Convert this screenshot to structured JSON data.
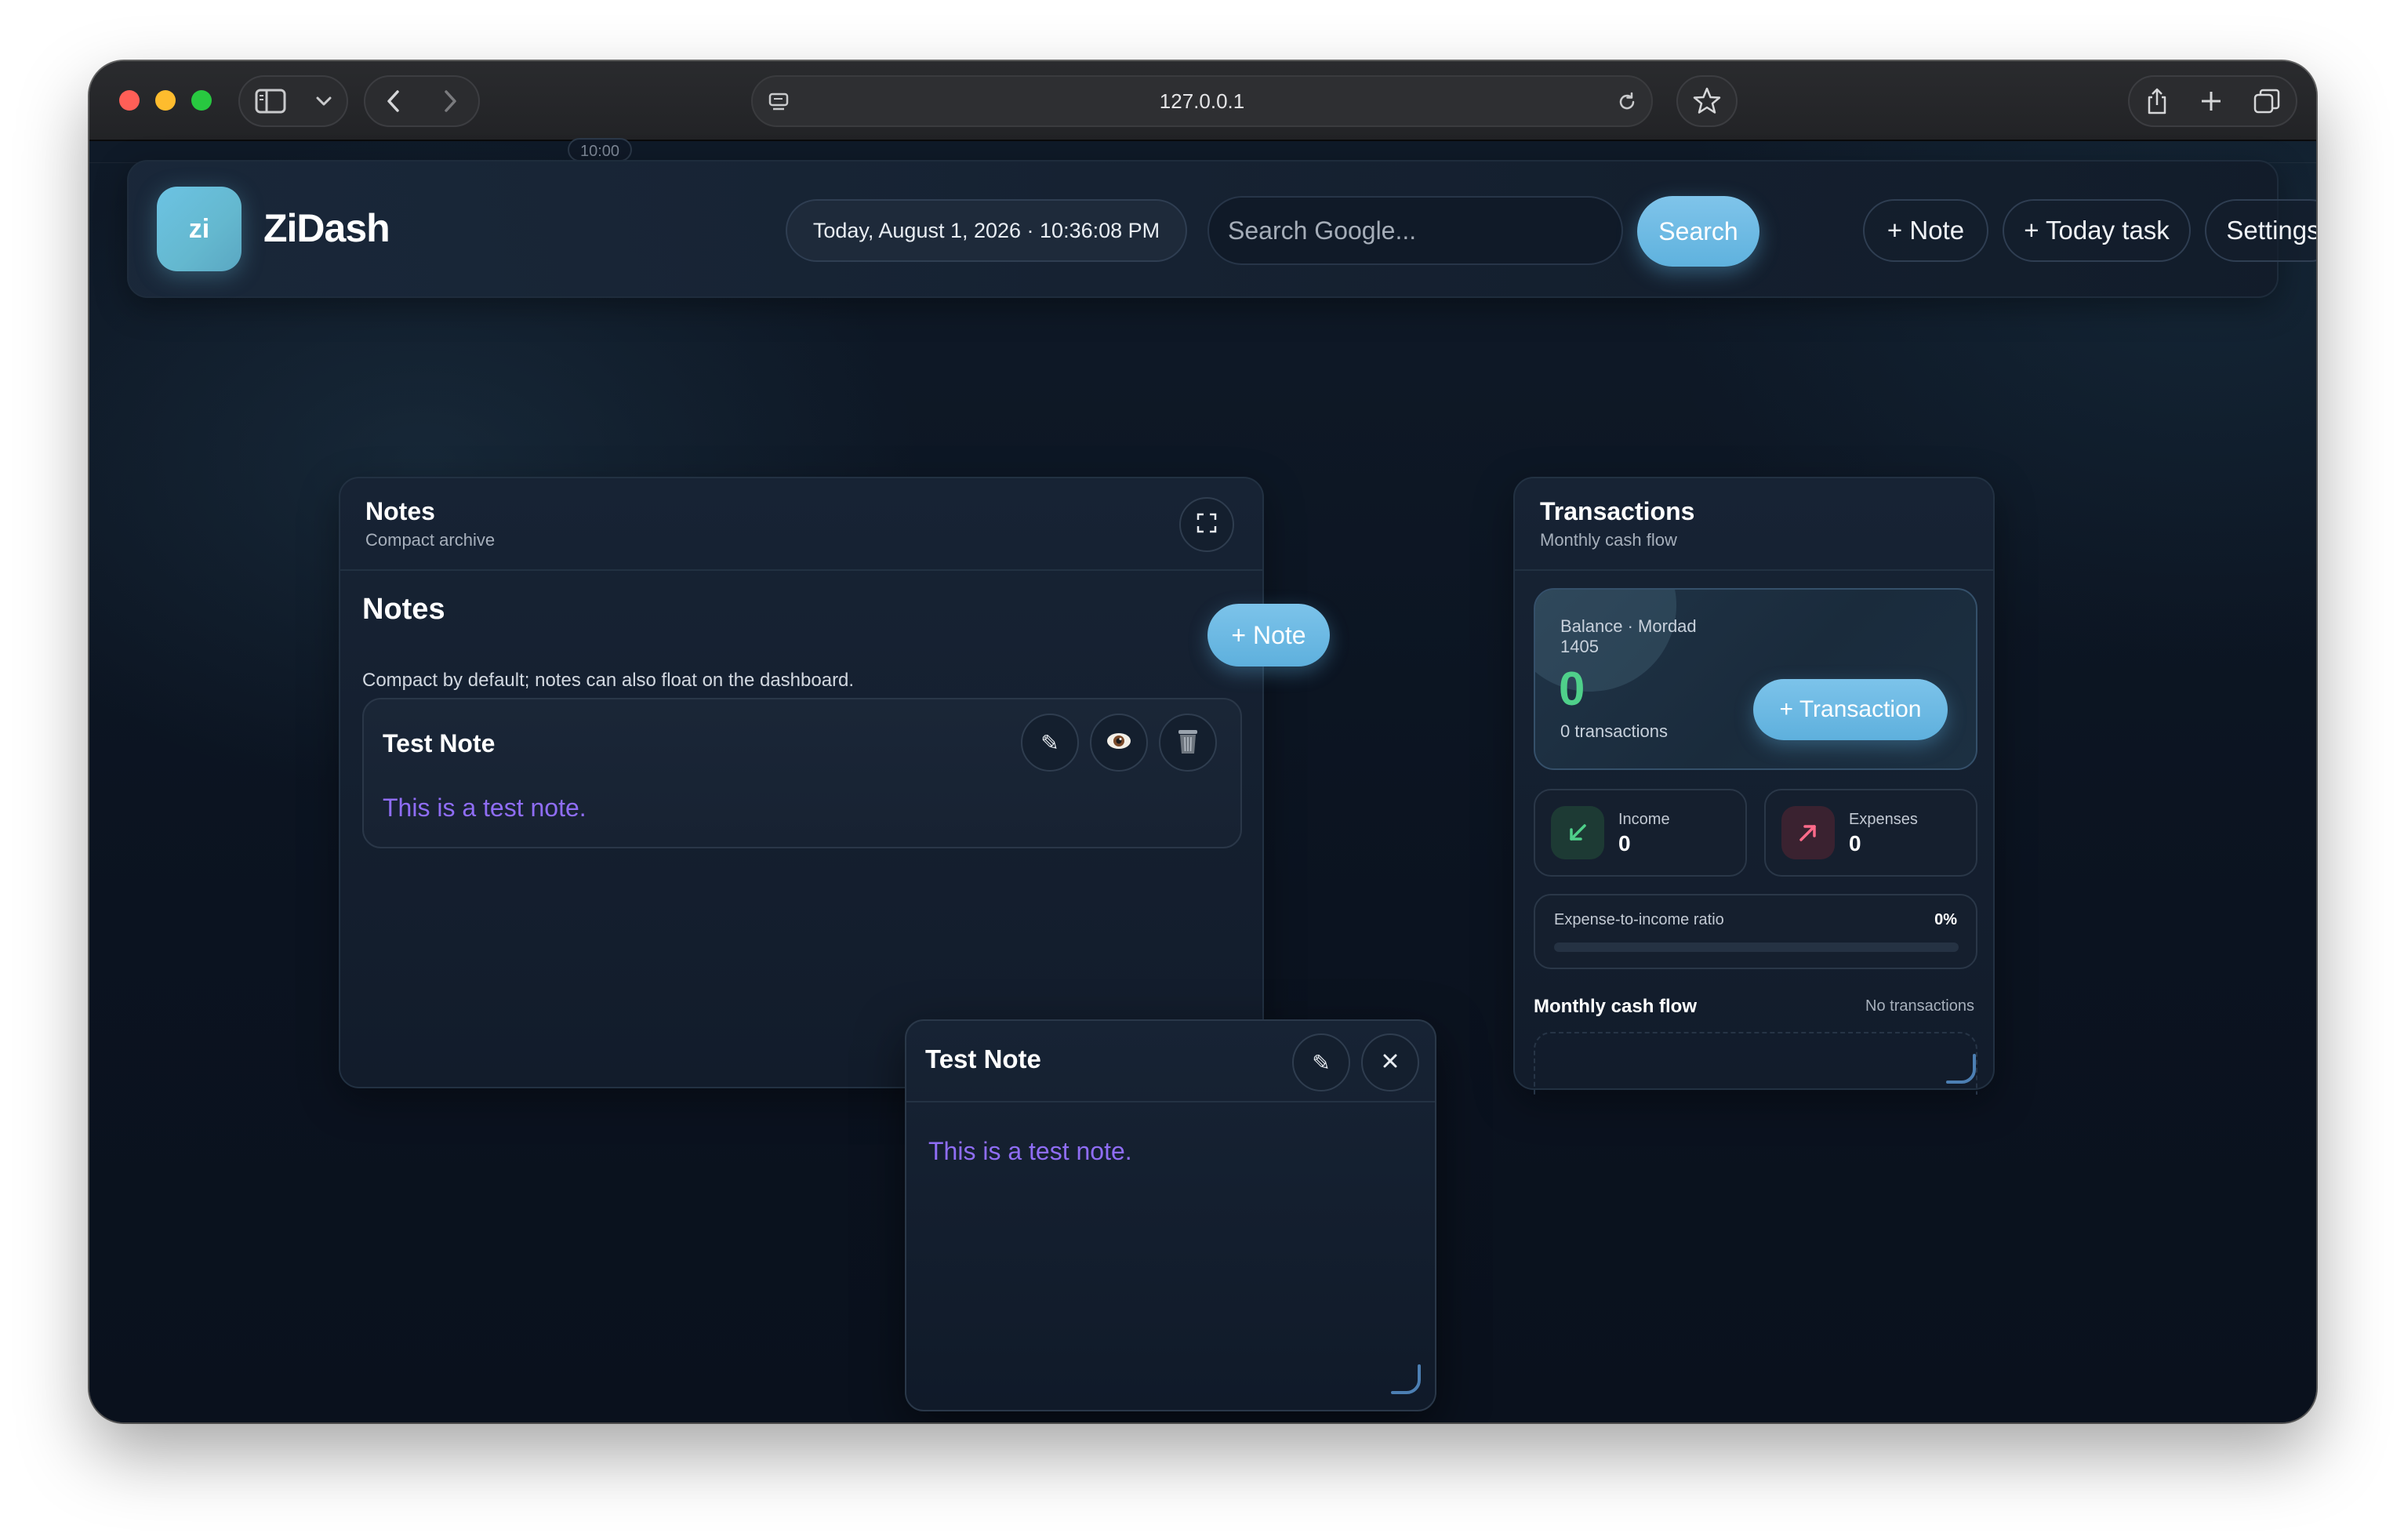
{
  "browser": {
    "url": "127.0.0.1",
    "ghost_time": "10:00"
  },
  "header": {
    "logo_text": "zi",
    "brand": "ZiDash",
    "datetime": "Today, August 1, 2026 · 10:36:08 PM",
    "search_placeholder": "Search Google...",
    "search_button": "Search",
    "note_button": "+ Note",
    "today_task_button": "+ Today task",
    "settings_button": "Settings"
  },
  "notes_panel": {
    "title": "Notes",
    "subtitle": "Compact archive",
    "section_title": "Notes",
    "add_button": "+ Note",
    "description": "Compact by default; notes can also float on the dashboard.",
    "notes": [
      {
        "title": "Test Note",
        "body": "This is a test note."
      }
    ]
  },
  "floating_note": {
    "title": "Test Note",
    "body": "This is a test note."
  },
  "transactions": {
    "title": "Transactions",
    "subtitle": "Monthly cash flow",
    "balance_label": "Balance · Mordad 1405",
    "balance_value": "0",
    "transactions_count": "0 transactions",
    "add_button": "+ Transaction",
    "income_label": "Income",
    "income_value": "0",
    "expenses_label": "Expenses",
    "expenses_value": "0",
    "ratio_label": "Expense-to-income ratio",
    "ratio_value": "0%",
    "ratio_fraction": 0,
    "cashflow_label": "Monthly cash flow",
    "cashflow_status": "No transactions"
  },
  "colors": {
    "accent": "#5eb0dd",
    "note_text": "#8f6df5",
    "balance": "#4fd08a",
    "income": "#4fd08a",
    "expense": "#ff6b8a"
  }
}
